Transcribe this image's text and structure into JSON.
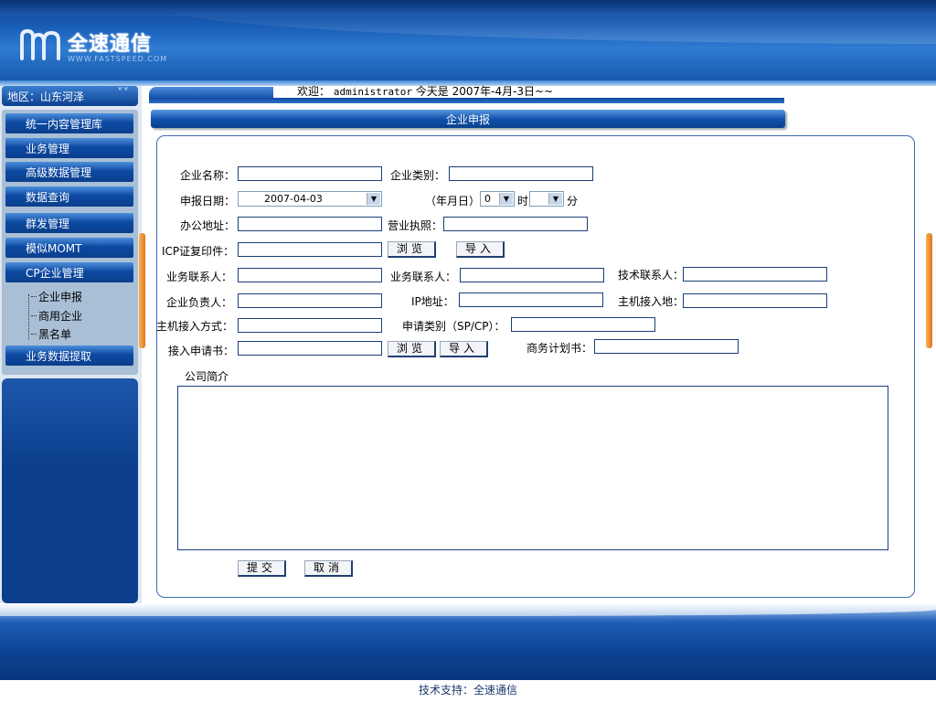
{
  "header": {
    "logo_text": "全速通信",
    "logo_sub": "WWW.FASTSPEED.COM"
  },
  "sidebar": {
    "region_label": "地区：山东河泽",
    "items": [
      {
        "label": "统一内容管理库"
      },
      {
        "label": "业务管理"
      },
      {
        "label": "高级数据管理"
      },
      {
        "label": "数据查询"
      },
      {
        "label": "群发管理"
      },
      {
        "label": "模似MOMT"
      },
      {
        "label": "CP企业管理"
      },
      {
        "label": "业务数据提取"
      }
    ],
    "sub_items": [
      {
        "label": "企业申报"
      },
      {
        "label": "商用企业"
      },
      {
        "label": "黑名单"
      }
    ]
  },
  "welcome": {
    "prefix": "欢迎：",
    "user": "administrator",
    "date_text": "今天是 2007年-4月-3日~~"
  },
  "title": "企业申报",
  "form": {
    "company_name_label": "企业名称：",
    "company_type_label": "企业类别：",
    "apply_date_label": "申报日期：",
    "apply_date_value": "2007-04-03",
    "ymd_label": "（年月日）",
    "hour_value": "0",
    "hour_unit": "时",
    "minute_value": "",
    "minute_unit": "分",
    "office_address_label": "办公地址：",
    "business_license_label": "营业执照：",
    "icp_label": "ICP证复印件：",
    "browse_label": "浏览",
    "import_label": "导入",
    "biz_contact_label": "业务联系人：",
    "biz_contact2_label": "业务联系人：",
    "tech_contact_label": "技术联系人：",
    "legal_person_label": "企业负责人：",
    "ip_label": "IP地址：",
    "host_location_label": "主机接入地：",
    "host_access_label": "主机接入方式：",
    "apply_type_label": "申请类别（SP/CP）：",
    "access_app_label": "接入申请书：",
    "business_plan_label": "商务计划书：",
    "intro_label": "公司简介",
    "submit_label": "提交",
    "cancel_label": "取消"
  },
  "footer": {
    "support_text": "技术支持：全速通信"
  },
  "colors": {
    "brand_blue": "#0b3f8c",
    "accent_orange": "#e2761a"
  }
}
